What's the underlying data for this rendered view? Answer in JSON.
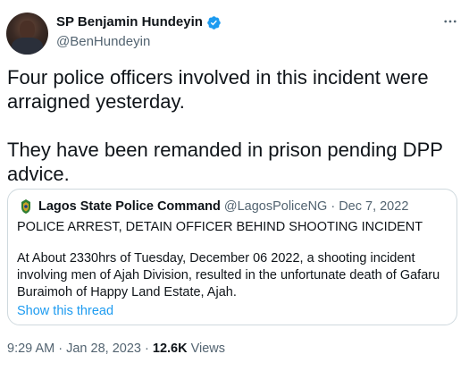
{
  "author": {
    "display_name": "SP Benjamin Hundeyin",
    "handle": "@BenHundeyin",
    "verified_icon": "verified-badge-icon",
    "more_icon": "more-options-icon"
  },
  "tweet": {
    "text": "Four police officers involved in this incident were arraigned yesterday.\n\nThey have been remanded in prison pending DPP advice."
  },
  "quote": {
    "avatar_icon": "police-crest-icon",
    "display_name": "Lagos State Police Command",
    "handle": "@LagosPoliceNG",
    "separator": "·",
    "date": "Dec 7, 2022",
    "title": "POLICE ARREST, DETAIN OFFICER BEHIND SHOOTING INCIDENT",
    "body": "At About 2330hrs of Tuesday, December 06 2022, a shooting incident involving men of Ajah Division, resulted in the unfortunate death of Gafaru Buraimoh of Happy Land Estate, Ajah.",
    "show_thread": "Show this thread"
  },
  "meta": {
    "time": "9:29 AM",
    "separator": "·",
    "date": "Jan 28, 2023",
    "views_count": "12.6K",
    "views_label": "Views"
  },
  "colors": {
    "accent": "#1d9bf0",
    "text": "#0f1419",
    "secondary": "#536471",
    "border": "#cfd9de"
  }
}
